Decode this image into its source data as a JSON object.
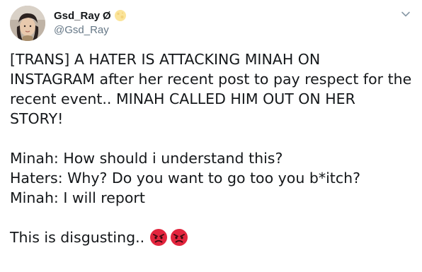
{
  "tweet": {
    "author": {
      "display_name": "Gsd_Ray",
      "name_symbol": "Ø",
      "handle": "@Gsd_Ray",
      "name_emoji_icon": "full-moon-icon"
    },
    "menu_icon": "chevron-down-icon",
    "lines": {
      "p1": [
        "[TRANS] A HATER IS ATTACKING MINAH ON",
        "INSTAGRAM after her recent post to pay respect for the",
        "recent event.. MINAH CALLED HIM OUT ON HER",
        "STORY!"
      ],
      "p2": [
        "Minah: How should i understand this?",
        "Haters: Why? Do you want to go too you b*itch?",
        "Minah: I will report"
      ],
      "p3": "This is disgusting.."
    },
    "trailing_emojis": [
      "angry-face-icon",
      "angry-face-icon"
    ],
    "colors": {
      "text": "#14171a",
      "secondary": "#657786",
      "angry_face": "#e2253d"
    }
  }
}
